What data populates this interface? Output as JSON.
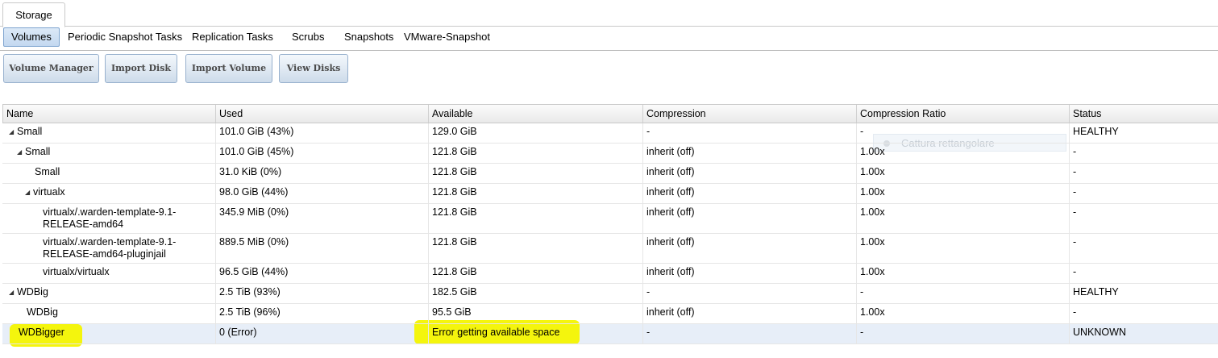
{
  "top_tab": {
    "label": "Storage"
  },
  "subtabs": [
    {
      "label": "Volumes",
      "active": true
    },
    {
      "label": "Periodic Snapshot Tasks",
      "active": false
    },
    {
      "label": "Replication Tasks",
      "active": false
    },
    {
      "label": "Scrubs",
      "active": false
    },
    {
      "label": "Snapshots",
      "active": false
    },
    {
      "label": "VMware-Snapshot",
      "active": false
    }
  ],
  "toolbar": {
    "volume_manager": "Volume Manager",
    "import_disk": "Import Disk",
    "import_volume": "Import Volume",
    "view_disks": "View Disks"
  },
  "grid": {
    "columns": [
      "Name",
      "Used",
      "Available",
      "Compression",
      "Compression Ratio",
      "Status"
    ],
    "rows": [
      {
        "name": "Small",
        "used": "101.0 GiB (43%)",
        "available": "129.0 GiB",
        "compression": "-",
        "ratio": "-",
        "status": "HEALTHY"
      },
      {
        "name": "Small",
        "used": "101.0 GiB (45%)",
        "available": "121.8 GiB",
        "compression": "inherit (off)",
        "ratio": "1.00x",
        "status": "-"
      },
      {
        "name": "Small",
        "used": "31.0 KiB (0%)",
        "available": "121.8 GiB",
        "compression": "inherit (off)",
        "ratio": "1.00x",
        "status": "-"
      },
      {
        "name": "virtualx",
        "used": "98.0 GiB (44%)",
        "available": "121.8 GiB",
        "compression": "inherit (off)",
        "ratio": "1.00x",
        "status": "-"
      },
      {
        "name": "virtualx/.warden-template-9.1-\nRELEASE-amd64",
        "used": "345.9 MiB (0%)",
        "available": "121.8 GiB",
        "compression": "inherit (off)",
        "ratio": "1.00x",
        "status": "-"
      },
      {
        "name": "virtualx/.warden-template-9.1-\nRELEASE-amd64-pluginjail",
        "used": "889.5 MiB (0%)",
        "available": "121.8 GiB",
        "compression": "inherit (off)",
        "ratio": "1.00x",
        "status": "-"
      },
      {
        "name": "virtualx/virtualx",
        "used": "96.5 GiB (44%)",
        "available": "121.8 GiB",
        "compression": "inherit (off)",
        "ratio": "1.00x",
        "status": "-"
      },
      {
        "name": "WDBig",
        "used": "2.5 TiB (93%)",
        "available": "182.5 GiB",
        "compression": "-",
        "ratio": "-",
        "status": "HEALTHY"
      },
      {
        "name": "WDBig",
        "used": "2.5 TiB (96%)",
        "available": "95.5 GiB",
        "compression": "inherit (off)",
        "ratio": "1.00x",
        "status": "-"
      },
      {
        "name": "WDBigger",
        "used": "0 (Error)",
        "available": "Error getting available space",
        "compression": "-",
        "ratio": "-",
        "status": "UNKNOWN"
      }
    ]
  },
  "ghost_tooltip": {
    "label": "Cattura rettangolare"
  },
  "colors": {
    "highlight": "#f4f400",
    "selected_row": "#e7eef8",
    "accent_border": "#7ea4cf"
  },
  "icons": {
    "expander": "triangle-down-icon"
  }
}
